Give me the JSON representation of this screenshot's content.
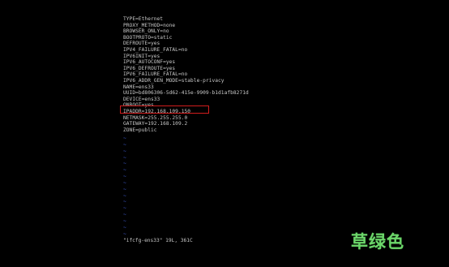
{
  "editor": {
    "file_lines": [
      "TYPE=Ethernet",
      "PROXY_METHOD=none",
      "BROWSER_ONLY=no",
      "BOOTPROTO=static",
      "DEFROUTE=yes",
      "IPV4_FAILURE_FATAL=no",
      "IPV6INIT=yes",
      "IPV6_AUTOCONF=yes",
      "IPV6_DEFROUTE=yes",
      "IPV6_FAILURE_FATAL=no",
      "IPV6_ADDR_GEN_MODE=stable-privacy",
      "NAME=ens33",
      "UUID=bd806306-5d62-415e-9909-b1d1afb8271d",
      "DEVICE=ens33",
      "ONBOOT=yes",
      "IPADDR=192.168.109.150",
      "NETMASK=255.255.255.0",
      "GATEWAY=192.168.109.2",
      "ZONE=public"
    ],
    "highlighted_line": "IPADDR=192.168.109.150",
    "empty_line_marker": "~",
    "empty_line_count": 16,
    "status_line": "\"ifcfg-ens33\" 19L, 361C"
  },
  "colors": {
    "background": "#000000",
    "text": "#c8c8c8",
    "tilde": "#3f5fd8",
    "highlight_border": "#d21d1d",
    "watermark": "#6cd66a"
  },
  "watermark": {
    "text": "草绿色"
  }
}
